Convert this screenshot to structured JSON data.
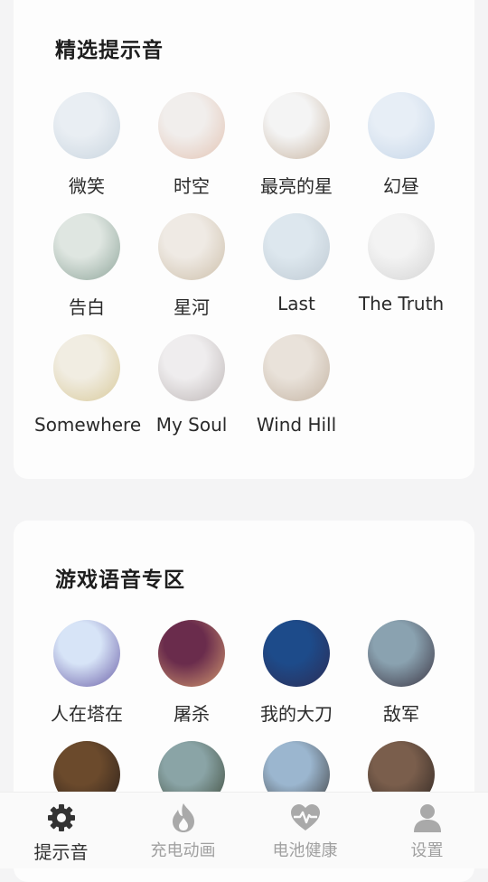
{
  "sections": {
    "selected": {
      "title": "精选提示音",
      "items": [
        {
          "label": "微笑",
          "colors": [
            "#e9eef3",
            "#c9d5df"
          ]
        },
        {
          "label": "时空",
          "colors": [
            "#f1eeec",
            "#e3c4b4"
          ]
        },
        {
          "label": "最亮的星",
          "colors": [
            "#f4f4f4",
            "#c9b6a3"
          ]
        },
        {
          "label": "幻昼",
          "colors": [
            "#e7eef6",
            "#c6d6e8"
          ]
        },
        {
          "label": "告白",
          "colors": [
            "#dfe6e1",
            "#8ea59a"
          ]
        },
        {
          "label": "星河",
          "colors": [
            "#efeae4",
            "#cdbfaa"
          ]
        },
        {
          "label": "Last",
          "colors": [
            "#dde7ee",
            "#bfcad3"
          ]
        },
        {
          "label": "The Truth",
          "colors": [
            "#f3f3f3",
            "#d4d4d4"
          ]
        },
        {
          "label": "Somewhere",
          "colors": [
            "#f1ede2",
            "#d8c99a"
          ]
        },
        {
          "label": "My Soul",
          "colors": [
            "#efedee",
            "#bdb6b6"
          ]
        },
        {
          "label": "Wind Hill",
          "colors": [
            "#e9e2da",
            "#c4b4a3"
          ]
        }
      ]
    },
    "game": {
      "title": "游戏语音专区",
      "items": [
        {
          "label": "人在塔在",
          "colors": [
            "#d7e4f7",
            "#6a5fa8"
          ]
        },
        {
          "label": "屠杀",
          "colors": [
            "#6a2c4c",
            "#d39a70"
          ]
        },
        {
          "label": "我的大刀",
          "colors": [
            "#1d4b8a",
            "#2c2c55"
          ]
        },
        {
          "label": "敌军",
          "colors": [
            "#8aa2b0",
            "#3a3442"
          ]
        },
        {
          "label": "",
          "colors": [
            "#6b4a2c",
            "#2a1f1a"
          ]
        },
        {
          "label": "",
          "colors": [
            "#8aa4a6",
            "#3d4a3a"
          ]
        },
        {
          "label": "",
          "colors": [
            "#9bb6cf",
            "#3f3f3f"
          ]
        },
        {
          "label": "",
          "colors": [
            "#7a5e4c",
            "#2e2622"
          ]
        }
      ]
    }
  },
  "tabs": [
    {
      "label": "提示音",
      "icon": "gear-icon",
      "active": true
    },
    {
      "label": "充电动画",
      "icon": "flame-icon",
      "active": false
    },
    {
      "label": "电池健康",
      "icon": "heart-pulse-icon",
      "active": false
    },
    {
      "label": "设置",
      "icon": "person-icon",
      "active": false
    }
  ],
  "colors": {
    "accent": "#3a3a3a",
    "inactive": "#a0a0a0",
    "card": "#fdfdfd",
    "background": "#f4f4f5"
  }
}
